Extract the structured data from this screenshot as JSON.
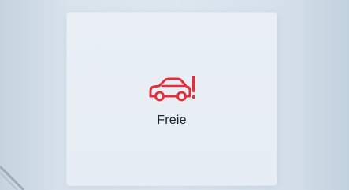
{
  "tile": {
    "label": "Freie",
    "icon": "car-warning-icon",
    "icon_color": "#e0303a"
  }
}
